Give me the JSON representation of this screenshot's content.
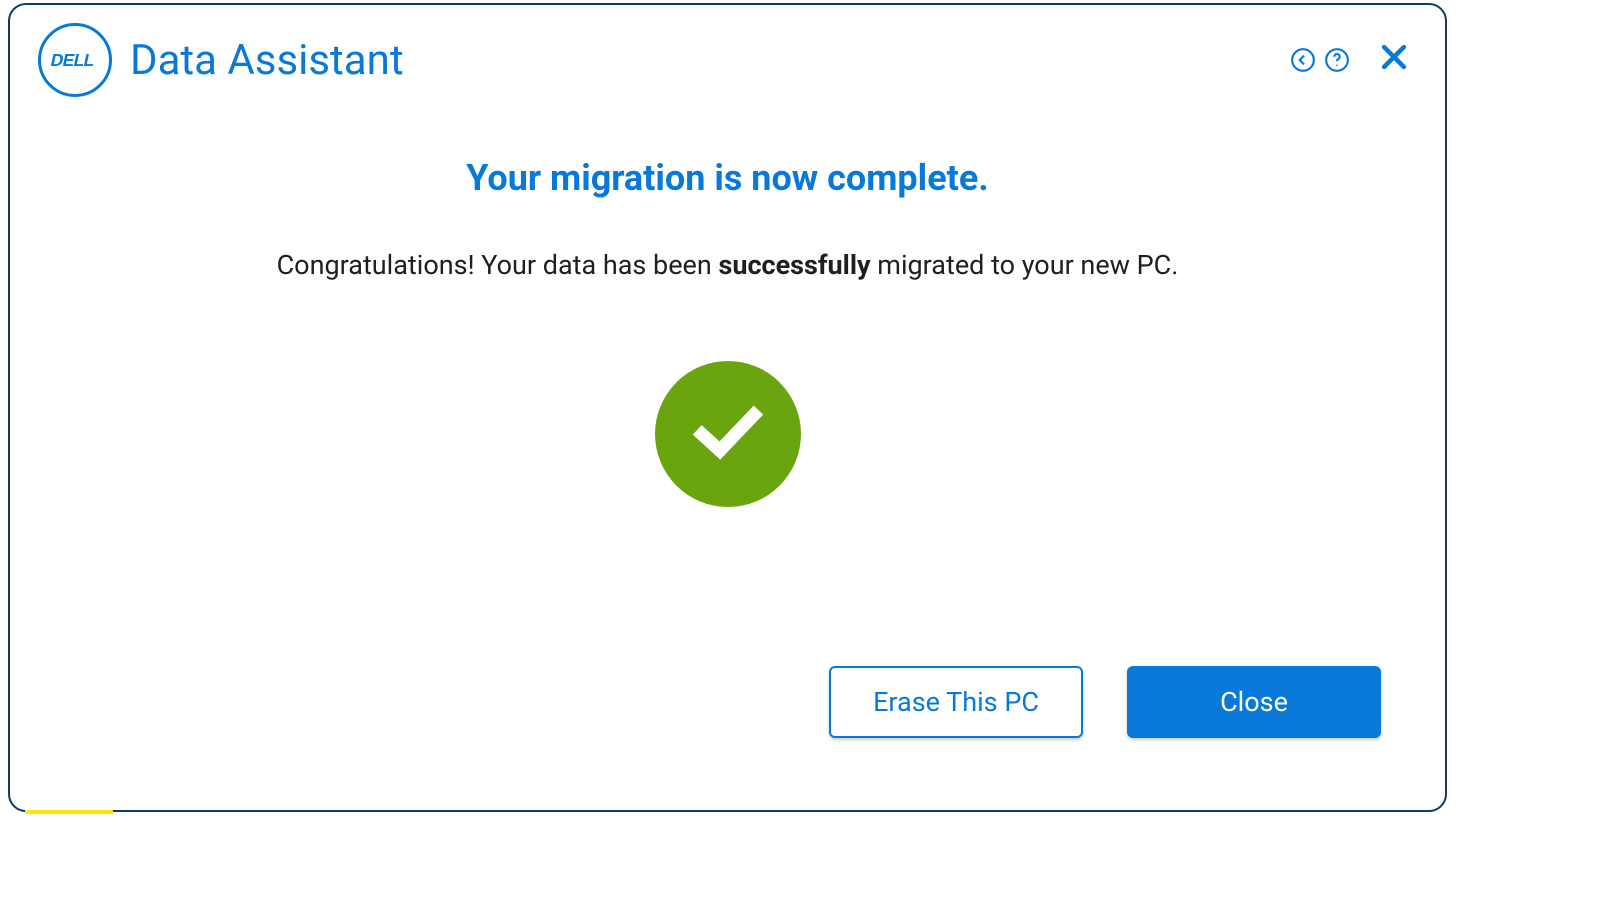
{
  "header": {
    "app_title": "Data Assistant",
    "logo_text": "DELL"
  },
  "main": {
    "headline": "Your migration is now complete.",
    "subtext_prefix": "Congratulations! Your data has been ",
    "subtext_strong": "successfully",
    "subtext_suffix": " migrated to your new PC."
  },
  "footer": {
    "erase_label": "Erase This PC",
    "close_label": "Close"
  },
  "colors": {
    "brand": "#0979d9",
    "success": "#6aa510"
  }
}
